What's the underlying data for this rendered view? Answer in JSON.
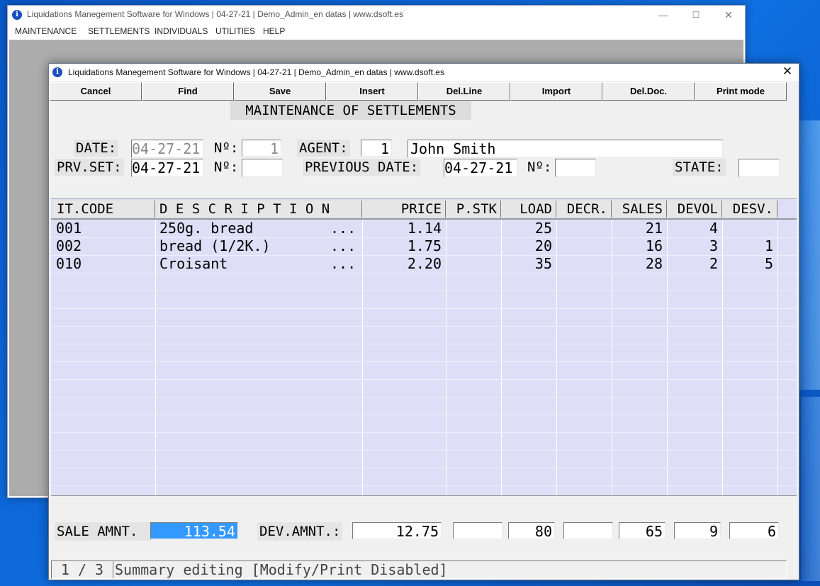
{
  "back_window": {
    "title": "Liquidations Manegement Software for Windows  |  04-27-21  |  Demo_Admin_en datas  |  www.dsoft.es",
    "controls": {
      "minimize": "—",
      "maximize": "☐",
      "close": "✕"
    },
    "menu": [
      "MAINTENANCE",
      "SETTLEMENTS",
      "INDIVIDUALS",
      "UTILITIES",
      "HELP"
    ]
  },
  "front_window": {
    "title": "Liquidations Manegement Software for Windows  |  04-27-21  |  Demo_Admin_en datas  |  www.dsoft.es",
    "close": "✕",
    "info_glyph": "i"
  },
  "toolbar": [
    "Cancel",
    "Find",
    "Save",
    "Insert",
    "Del.Line",
    "Import",
    "Del.Doc.",
    "Print mode"
  ],
  "form": {
    "title": "MAINTENANCE OF SETTLEMENTS",
    "date_label": "DATE:",
    "date_value": "04-27-21",
    "no_label": "Nº:",
    "no_value": "1",
    "agent_label": "AGENT:",
    "agent_code": "1",
    "agent_name": "John Smith",
    "prv_set_label": "PRV.SET:",
    "prv_set_value": "04-27-21",
    "no2_label": "Nº:",
    "no2_value": "",
    "previous_date_label": "PREVIOUS DATE:",
    "previous_date_value": "04-27-21",
    "no3_label": "Nº:",
    "no3_value": "",
    "state_label": "STATE:",
    "state_value": ""
  },
  "grid": {
    "columns": [
      "IT.CODE",
      "D E S C R I P T I O N",
      "PRICE",
      "P.STK",
      "LOAD",
      "DECR.",
      "SALES",
      "DEVOL",
      "DESV."
    ],
    "rows": [
      {
        "code": "001",
        "desc": "250g. bread",
        "dots": "...",
        "price": "1.14",
        "pstk": "",
        "load": "25",
        "decr": "",
        "sales": "21",
        "devol": "4",
        "desv": ""
      },
      {
        "code": "002",
        "desc": "bread (1/2K.)",
        "dots": "...",
        "price": "1.75",
        "pstk": "",
        "load": "20",
        "decr": "",
        "sales": "16",
        "devol": "3",
        "desv": "1"
      },
      {
        "code": "010",
        "desc": "Croisant",
        "dots": "...",
        "price": "2.20",
        "pstk": "",
        "load": "35",
        "decr": "",
        "sales": "28",
        "devol": "2",
        "desv": "5"
      }
    ]
  },
  "totals": {
    "sale_amnt_label": "SALE AMNT.",
    "sale_amnt_value": "113.54",
    "dev_amnt_label": "DEV.AMNT.:",
    "dev_amnt_value": "12.75",
    "pstk_total": "",
    "load_total": "80",
    "decr_total": "",
    "sales_total": "65",
    "devol_total": "9",
    "desv_total": "6"
  },
  "status": {
    "page": "1 / 3",
    "message": "Summary editing [Modify/Print Disabled]"
  },
  "colors": {
    "grid_bg": "#dedff7",
    "highlight": "#3399ff",
    "desktop": "#0f6fe0"
  }
}
